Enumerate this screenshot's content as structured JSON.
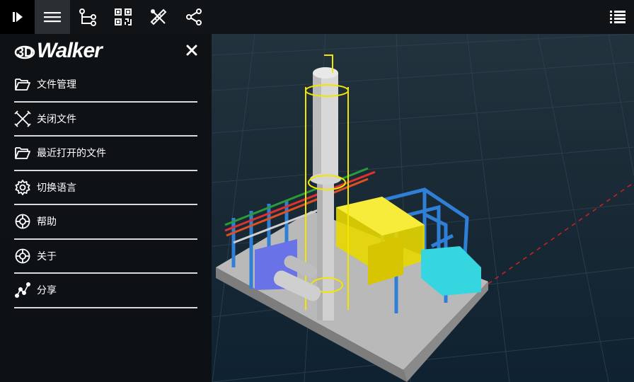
{
  "toolbar": {
    "buttons": [
      {
        "icon": "play-panel-icon"
      },
      {
        "icon": "hamburger-menu-icon"
      },
      {
        "icon": "tree-structure-icon"
      },
      {
        "icon": "qr-code-icon"
      },
      {
        "icon": "measure-tools-icon"
      },
      {
        "icon": "share-icon"
      }
    ],
    "right_icon": "list-view-icon"
  },
  "sidebar": {
    "brand": "Walker",
    "brand_logo": "3d-logo-icon",
    "close_icon": "close-icon",
    "items": [
      {
        "label": "文件管理",
        "icon": "folder-open-icon"
      },
      {
        "label": "关闭文件",
        "icon": "close-file-icon"
      },
      {
        "label": "最近打开的文件",
        "icon": "folder-open-icon"
      },
      {
        "label": "切换语言",
        "icon": "gear-icon"
      },
      {
        "label": "帮助",
        "icon": "help-lifebuoy-icon"
      },
      {
        "label": "关于",
        "icon": "about-lifebuoy-icon"
      },
      {
        "label": "分享",
        "icon": "share-graph-icon"
      }
    ]
  },
  "colors": {
    "toolbar_bg": "#111417",
    "sidebar_bg": "#0e1114",
    "divider": "#d9d9d9",
    "viewport_bg": "#1b2b36",
    "model_yellow": "#f2e600",
    "model_blue": "#2f7fd6",
    "model_cyan": "#35d6e0",
    "model_gray": "#c9c9c9"
  }
}
